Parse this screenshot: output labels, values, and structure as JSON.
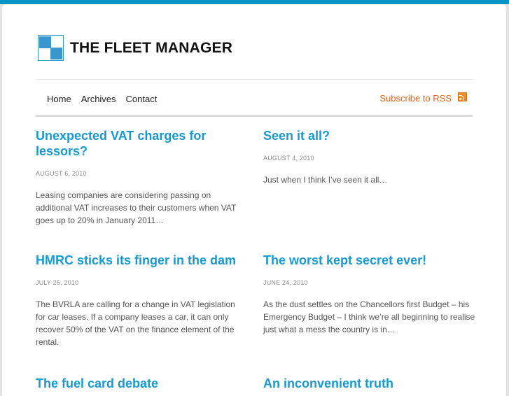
{
  "site": {
    "title": "THE FLEET MANAGER",
    "accent_color": "#0a94c8",
    "link_color": "#1899cf",
    "rss_color": "#e2631e"
  },
  "nav": {
    "items": [
      {
        "label": "Home"
      },
      {
        "label": "Archives"
      },
      {
        "label": "Contact"
      }
    ],
    "rss_label": "Subscribe to RSS",
    "rss_icon": "rss-feed-icon"
  },
  "posts": [
    {
      "title": "Unexpected VAT charges for lessors?",
      "date": "August 6, 2010",
      "excerpt": "Leasing companies are considering passing on additional VAT increases to their customers when VAT goes up to 20% in January 2011…"
    },
    {
      "title": "Seen it all?",
      "date": "August 4, 2010",
      "excerpt": "Just when I think I’ve seen it all…"
    },
    {
      "title": "HMRC sticks its finger in the dam",
      "date": "July 25, 2010",
      "excerpt": "The BVRLA are calling for a change in VAT legislation for car leases. If a company leases a car, it can only recover 50% of the VAT on the finance element of the rental."
    },
    {
      "title": "The worst kept secret ever!",
      "date": "June 24, 2010",
      "excerpt": "As the dust settles on the Chancellors first Budget – his Emergency Budget – I think we’re all beginning to realise just what a mess the country is in…"
    },
    {
      "title": "The fuel card debate",
      "date": "",
      "excerpt": ""
    },
    {
      "title": "An inconvenient truth",
      "date": "",
      "excerpt": ""
    }
  ]
}
